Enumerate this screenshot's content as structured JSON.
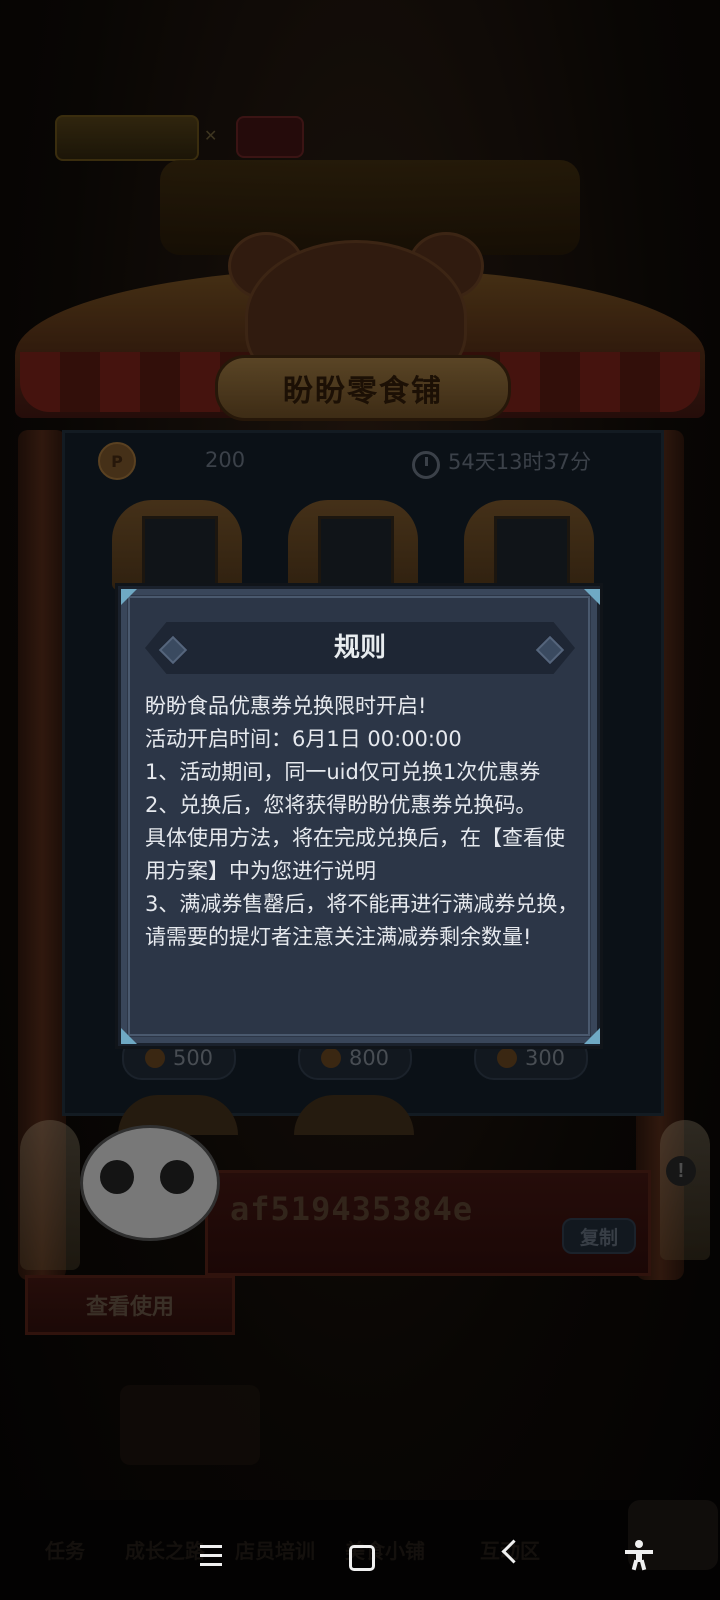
{
  "shop": {
    "name": "盼盼零食铺",
    "coins": "200",
    "timer": "54天13时37分"
  },
  "prices": [
    "500",
    "800",
    "300"
  ],
  "redeem": {
    "code": "af519435384e",
    "copy_label": "复制",
    "view_usage_label": "查看使用"
  },
  "modal": {
    "title": "规则",
    "lines": [
      "盼盼食品优惠券兑换限时开启!",
      "活动开启时间：6月1日 00:00:00",
      "1、活动期间，同一uid仅可兑换1次优惠券",
      "2、兑换后，您将获得盼盼优惠券兑换码。",
      "具体使用方法，将在完成兑换后，在【查看使用方案】中为您进行说明",
      "3、满减券售罄后，将不能再进行满减券兑换，请需要的提灯者注意关注满减券剩余数量!"
    ]
  },
  "tabs": [
    "任务",
    "成长之路",
    "店员培训",
    "美食小铺",
    "互动区"
  ],
  "colors": {
    "modal_bg": "#2c3647",
    "modal_text": "#e6e9ee",
    "corner_accent": "#6fa9c4"
  }
}
